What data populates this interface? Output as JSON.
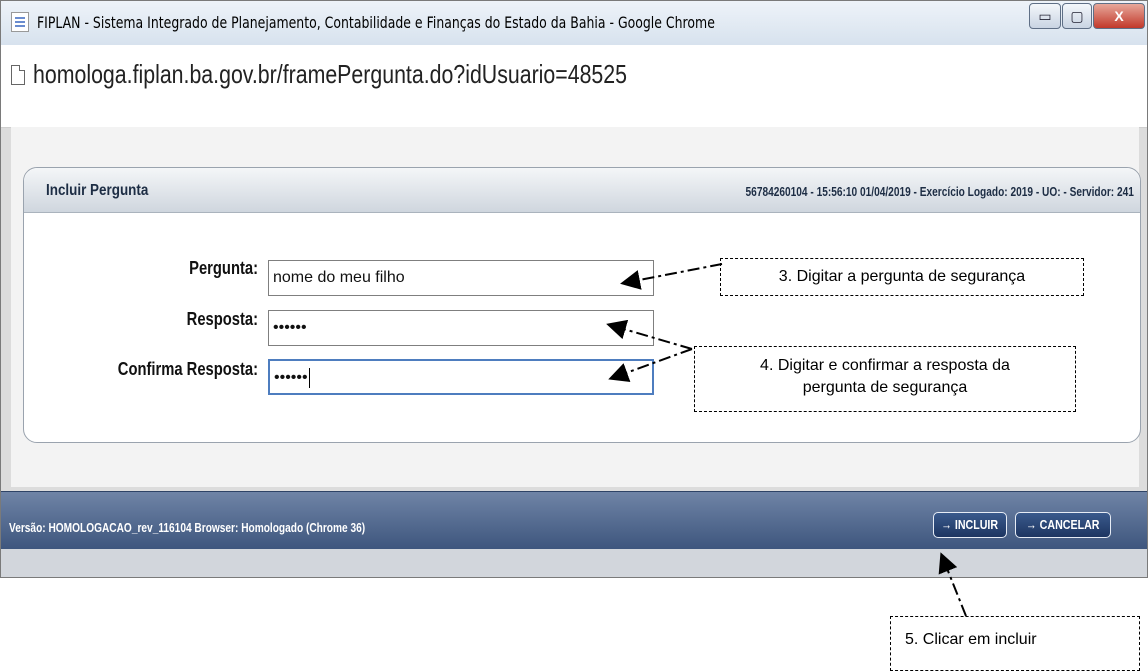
{
  "window": {
    "title": "FIPLAN - Sistema Integrado de Planejamento, Contabilidade e Finanças do Estado da Bahia - Google Chrome",
    "controls": {
      "minimize": "▭",
      "maximize": "▢",
      "close": "X"
    }
  },
  "address": {
    "url": "homologa.fiplan.ba.gov.br/framePergunta.do?idUsuario=48525"
  },
  "panel": {
    "title": "Incluir Pergunta",
    "info": "56784260104 - 15:56:10 01/04/2019 - Exercício Logado: 2019 - UO:        - Servidor: 241"
  },
  "form": {
    "pergunta": {
      "label": "Pergunta:",
      "value": "nome do meu filho"
    },
    "resposta": {
      "label": "Resposta:",
      "value": "••••••"
    },
    "confirma": {
      "label": "Confirma Resposta:",
      "value": "••••••"
    }
  },
  "status": {
    "version": "Versão: HOMOLOGACAO_rev_116104   Browser: Homologado (Chrome 36)",
    "incluir_label": "→ INCLUIR",
    "cancelar_label": "→ CANCELAR"
  },
  "annotations": {
    "step3": "3. Digitar a pergunta de segurança",
    "step4_line1": "4. Digitar e confirmar a resposta da",
    "step4_line2": "pergunta de segurança",
    "step5": "5. Clicar em incluir"
  }
}
